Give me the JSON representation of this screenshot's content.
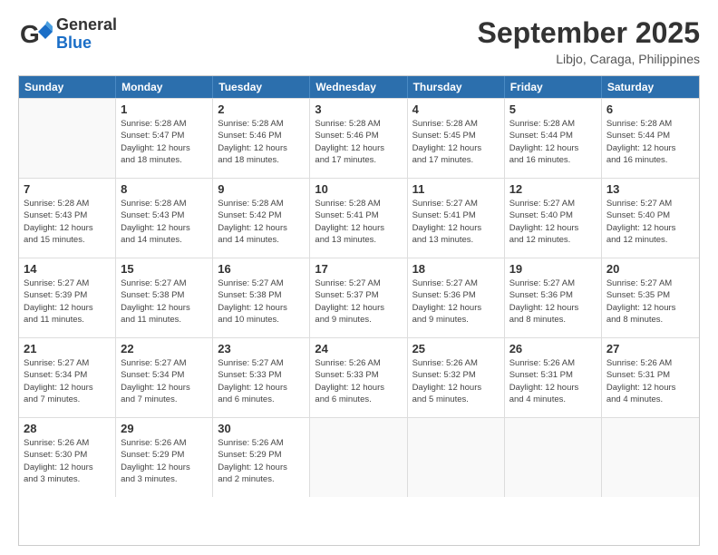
{
  "header": {
    "logo_general": "General",
    "logo_blue": "Blue",
    "month_title": "September 2025",
    "location": "Libjo, Caraga, Philippines"
  },
  "weekdays": [
    "Sunday",
    "Monday",
    "Tuesday",
    "Wednesday",
    "Thursday",
    "Friday",
    "Saturday"
  ],
  "weeks": [
    [
      {
        "day": "",
        "info": ""
      },
      {
        "day": "1",
        "info": "Sunrise: 5:28 AM\nSunset: 5:47 PM\nDaylight: 12 hours\nand 18 minutes."
      },
      {
        "day": "2",
        "info": "Sunrise: 5:28 AM\nSunset: 5:46 PM\nDaylight: 12 hours\nand 18 minutes."
      },
      {
        "day": "3",
        "info": "Sunrise: 5:28 AM\nSunset: 5:46 PM\nDaylight: 12 hours\nand 17 minutes."
      },
      {
        "day": "4",
        "info": "Sunrise: 5:28 AM\nSunset: 5:45 PM\nDaylight: 12 hours\nand 17 minutes."
      },
      {
        "day": "5",
        "info": "Sunrise: 5:28 AM\nSunset: 5:44 PM\nDaylight: 12 hours\nand 16 minutes."
      },
      {
        "day": "6",
        "info": "Sunrise: 5:28 AM\nSunset: 5:44 PM\nDaylight: 12 hours\nand 16 minutes."
      }
    ],
    [
      {
        "day": "7",
        "info": "Sunrise: 5:28 AM\nSunset: 5:43 PM\nDaylight: 12 hours\nand 15 minutes."
      },
      {
        "day": "8",
        "info": "Sunrise: 5:28 AM\nSunset: 5:43 PM\nDaylight: 12 hours\nand 14 minutes."
      },
      {
        "day": "9",
        "info": "Sunrise: 5:28 AM\nSunset: 5:42 PM\nDaylight: 12 hours\nand 14 minutes."
      },
      {
        "day": "10",
        "info": "Sunrise: 5:28 AM\nSunset: 5:41 PM\nDaylight: 12 hours\nand 13 minutes."
      },
      {
        "day": "11",
        "info": "Sunrise: 5:27 AM\nSunset: 5:41 PM\nDaylight: 12 hours\nand 13 minutes."
      },
      {
        "day": "12",
        "info": "Sunrise: 5:27 AM\nSunset: 5:40 PM\nDaylight: 12 hours\nand 12 minutes."
      },
      {
        "day": "13",
        "info": "Sunrise: 5:27 AM\nSunset: 5:40 PM\nDaylight: 12 hours\nand 12 minutes."
      }
    ],
    [
      {
        "day": "14",
        "info": "Sunrise: 5:27 AM\nSunset: 5:39 PM\nDaylight: 12 hours\nand 11 minutes."
      },
      {
        "day": "15",
        "info": "Sunrise: 5:27 AM\nSunset: 5:38 PM\nDaylight: 12 hours\nand 11 minutes."
      },
      {
        "day": "16",
        "info": "Sunrise: 5:27 AM\nSunset: 5:38 PM\nDaylight: 12 hours\nand 10 minutes."
      },
      {
        "day": "17",
        "info": "Sunrise: 5:27 AM\nSunset: 5:37 PM\nDaylight: 12 hours\nand 9 minutes."
      },
      {
        "day": "18",
        "info": "Sunrise: 5:27 AM\nSunset: 5:36 PM\nDaylight: 12 hours\nand 9 minutes."
      },
      {
        "day": "19",
        "info": "Sunrise: 5:27 AM\nSunset: 5:36 PM\nDaylight: 12 hours\nand 8 minutes."
      },
      {
        "day": "20",
        "info": "Sunrise: 5:27 AM\nSunset: 5:35 PM\nDaylight: 12 hours\nand 8 minutes."
      }
    ],
    [
      {
        "day": "21",
        "info": "Sunrise: 5:27 AM\nSunset: 5:34 PM\nDaylight: 12 hours\nand 7 minutes."
      },
      {
        "day": "22",
        "info": "Sunrise: 5:27 AM\nSunset: 5:34 PM\nDaylight: 12 hours\nand 7 minutes."
      },
      {
        "day": "23",
        "info": "Sunrise: 5:27 AM\nSunset: 5:33 PM\nDaylight: 12 hours\nand 6 minutes."
      },
      {
        "day": "24",
        "info": "Sunrise: 5:26 AM\nSunset: 5:33 PM\nDaylight: 12 hours\nand 6 minutes."
      },
      {
        "day": "25",
        "info": "Sunrise: 5:26 AM\nSunset: 5:32 PM\nDaylight: 12 hours\nand 5 minutes."
      },
      {
        "day": "26",
        "info": "Sunrise: 5:26 AM\nSunset: 5:31 PM\nDaylight: 12 hours\nand 4 minutes."
      },
      {
        "day": "27",
        "info": "Sunrise: 5:26 AM\nSunset: 5:31 PM\nDaylight: 12 hours\nand 4 minutes."
      }
    ],
    [
      {
        "day": "28",
        "info": "Sunrise: 5:26 AM\nSunset: 5:30 PM\nDaylight: 12 hours\nand 3 minutes."
      },
      {
        "day": "29",
        "info": "Sunrise: 5:26 AM\nSunset: 5:29 PM\nDaylight: 12 hours\nand 3 minutes."
      },
      {
        "day": "30",
        "info": "Sunrise: 5:26 AM\nSunset: 5:29 PM\nDaylight: 12 hours\nand 2 minutes."
      },
      {
        "day": "",
        "info": ""
      },
      {
        "day": "",
        "info": ""
      },
      {
        "day": "",
        "info": ""
      },
      {
        "day": "",
        "info": ""
      }
    ]
  ]
}
